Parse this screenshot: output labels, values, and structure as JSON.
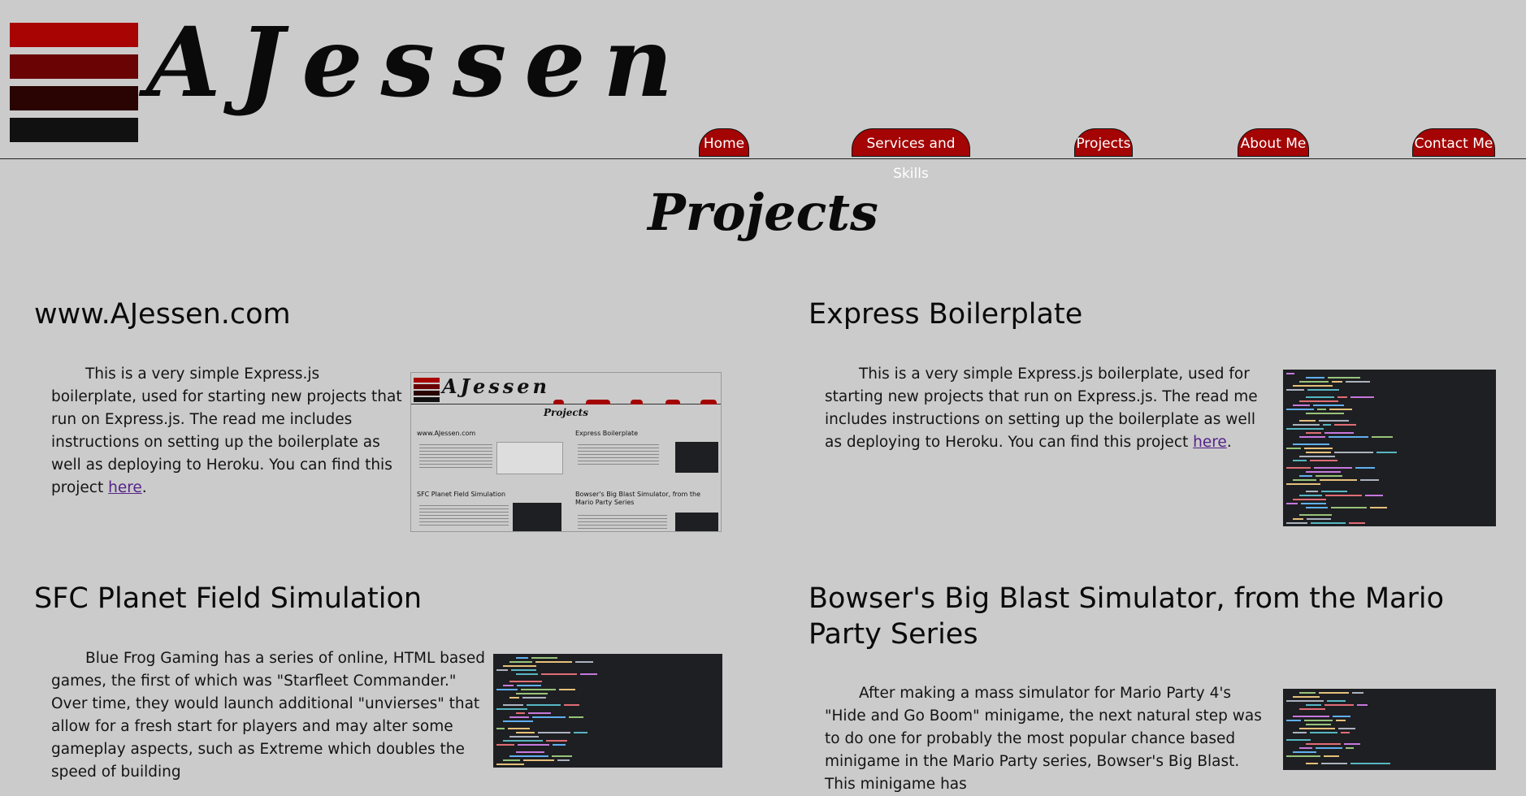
{
  "header": {
    "brand": "AJessen",
    "logo_colors": [
      "#a80404",
      "#6a0404",
      "#2a0303",
      "#111111"
    ]
  },
  "nav": {
    "accent": "#a40404",
    "items": [
      {
        "label": "Home"
      },
      {
        "label": "Services and Skills"
      },
      {
        "label": "Projects"
      },
      {
        "label": "About Me"
      },
      {
        "label": "Contact Me"
      }
    ]
  },
  "page": {
    "title": "Projects"
  },
  "projects": [
    {
      "title": "www.AJessen.com",
      "text": "This is a very simple Express.js boilerplate, used for starting new projects that run on Express.js. The read me includes instructions on setting up the boilerplate as well as deploying to Heroku. You can find this project ",
      "link": "here",
      "after": ".",
      "image": "website-screenshot"
    },
    {
      "title": "Express Boilerplate",
      "text": "This is a very simple Express.js boilerplate, used for starting new projects that run on Express.js. The read me includes instructions on setting up the boilerplate as well as deploying to Heroku. You can find this project ",
      "link": "here",
      "after": ".",
      "image": "code-screenshot"
    },
    {
      "title": "SFC Planet Field Simulation",
      "text": "Blue Frog Gaming has a series of online, HTML based games, the first of which was \"Starfleet Commander.\" Over time, they would launch additional \"unvierses\" that allow for a fresh start for players and may alter some gameplay aspects, such as Extreme which doubles the speed of building",
      "image": "code-screenshot"
    },
    {
      "title": "Bowser's Big Blast Simulator, from the Mario Party Series",
      "text": "After making a mass simulator for Mario Party 4's \"Hide and Go Boom\" minigame, the next natural step was to do one for probably the most popular chance based minigame in the Mario Party series, Bowser's Big Blast. This minigame has",
      "image": "code-screenshot"
    }
  ],
  "thumbnail": {
    "brand": "AJessen",
    "title": "Projects",
    "cards": [
      "www.AJessen.com",
      "Express Boilerplate",
      "SFC Planet Field Simulation",
      "Bowser's Big Blast Simulator, from the Mario Party Series"
    ]
  }
}
